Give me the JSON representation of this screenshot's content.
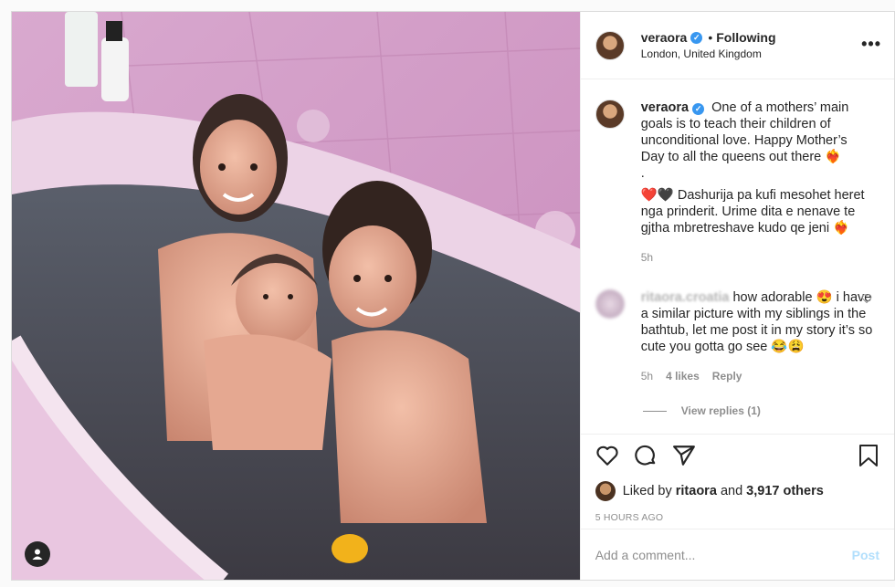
{
  "post": {
    "username": "veraora",
    "follow_state": "Following",
    "location": "London, United Kingdom",
    "more_icon": "more-options-icon",
    "caption": {
      "username": "veraora",
      "line1": "One of a mothers’ main goals is to teach their children of unconditional love. Happy Mother’s Day to all the queens out there",
      "line1_emoji": "❤️‍🔥",
      "dot": ".",
      "line2_prefix_hearts": "❤️🖤",
      "line2": "Dashurija pa kufi mesohet heret nga prinderit. Urime dita e nenave te gjtha mbretreshave kudo qe jeni",
      "line2_emoji": "❤️‍🔥",
      "time": "5h"
    },
    "comment": {
      "username": "ritaora.croatia",
      "text": "how adorable 😍 i have a similar picture with my siblings in the bathtub, let me post it in my story it’s so cute you gotta go see 😂😩",
      "time": "5h",
      "likes": "4 likes",
      "reply": "Reply",
      "view_replies": "View replies (1)"
    },
    "liked_by": {
      "prefix": "Liked by",
      "user": "ritaora",
      "middle": "and",
      "others": "3,917 others"
    },
    "time_ago": "5 HOURS AGO",
    "add_comment": {
      "placeholder": "Add a comment...",
      "post_label": "Post"
    }
  },
  "colors": {
    "verified": "#3897f0",
    "post_button_disabled": "#b2dffc",
    "muted": "#8e8e8e"
  }
}
